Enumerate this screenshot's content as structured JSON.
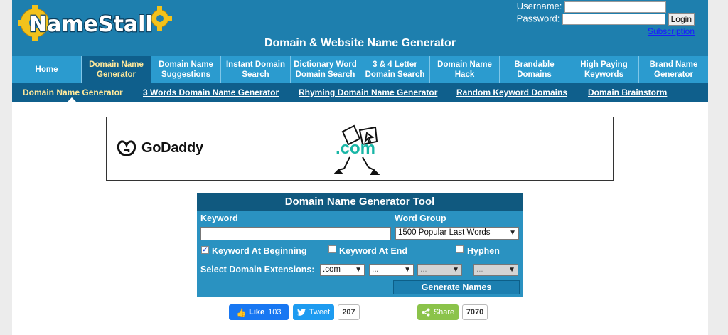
{
  "header": {
    "logo_text": "NameStall",
    "site_title": "Domain & Website Name Generator",
    "username_label": "Username:",
    "password_label": "Password:",
    "login_button": "Login",
    "subscription_link": "Subscription"
  },
  "nav": {
    "items": [
      {
        "label": "Home"
      },
      {
        "label": "Domain Name\nGenerator",
        "active": true
      },
      {
        "label": "Domain Name\nSuggestions"
      },
      {
        "label": "Instant Domain\nSearch"
      },
      {
        "label": "Dictionary Word\nDomain Search"
      },
      {
        "label": "3 & 4 Letter\nDomain Search"
      },
      {
        "label": "Domain Name\nHack"
      },
      {
        "label": "Brandable\nDomains"
      },
      {
        "label": "High Paying\nKeywords"
      },
      {
        "label": "Brand Name\nGenerator"
      }
    ]
  },
  "subnav": {
    "items": [
      {
        "label": "Domain Name Generator",
        "active": true
      },
      {
        "label": "3 Words Domain Name Generator"
      },
      {
        "label": "Rhyming Domain Name Generator"
      },
      {
        "label": "Random Keyword Domains"
      },
      {
        "label": "Domain Brainstorm"
      }
    ]
  },
  "ad": {
    "brand": "GoDaddy",
    "tagline": ".com"
  },
  "tool": {
    "title": "Domain Name Generator Tool",
    "keyword_label": "Keyword",
    "keyword_value": "",
    "word_group_label": "Word Group",
    "word_group_value": "1500 Popular Last Words",
    "opt_begin_label": "Keyword At Beginning",
    "opt_begin_checked": true,
    "opt_end_label": "Keyword At End",
    "opt_end_checked": false,
    "opt_hyphen_label": "Hyphen",
    "opt_hyphen_checked": false,
    "ext_label": "Select Domain Extensions:",
    "ext_values": [
      ".com",
      "...",
      "...",
      "..."
    ],
    "generate_button": "Generate Names"
  },
  "social": {
    "like_label": "Like",
    "like_count": "103",
    "tweet_label": "Tweet",
    "tweet_count": "207",
    "share_label": "Share",
    "share_count": "7070"
  },
  "colors": {
    "header_bg": "#1e7fae",
    "nav_bg": "#2b9bcf",
    "subnav_bg": "#0f5f8c",
    "active_text": "#ffe89a",
    "tool_bg": "#2a92c1",
    "facebook": "#1877f2",
    "twitter": "#1d9bf0",
    "share": "#8bc34a"
  }
}
